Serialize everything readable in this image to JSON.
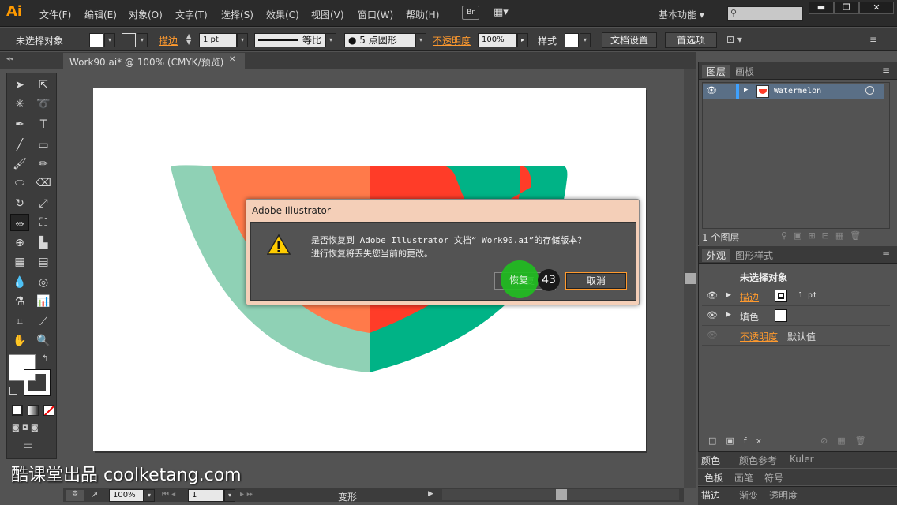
{
  "app": {
    "logo": "Ai",
    "workspace": "基本功能 ▾"
  },
  "menu": [
    "文件(F)",
    "编辑(E)",
    "对象(O)",
    "文字(T)",
    "选择(S)",
    "效果(C)",
    "视图(V)",
    "窗口(W)",
    "帮助(H)"
  ],
  "menu_buttons": {
    "bridge": "Br",
    "arrange": "▦▾"
  },
  "window_controls": {
    "minimize": "▬",
    "restore": "❐",
    "close": "✕"
  },
  "control_bar": {
    "selection": "未选择对象",
    "stroke_label": "描边",
    "stroke_weight": "1 pt",
    "stroke_profile": "等比",
    "brush": "● 5 点圆形",
    "opacity_label": "不透明度",
    "opacity_value": "100%",
    "style_label": "样式",
    "doc_setup": "文档设置",
    "preferences": "首选项"
  },
  "document_tab": {
    "title": "Work90.ai* @ 100% (CMYK/预览)",
    "close": "✕"
  },
  "status_bar": {
    "zoom": "100%",
    "page": "1",
    "tool_label": "变形"
  },
  "layers_panel": {
    "tabs": [
      "图层",
      "画板"
    ],
    "layer_name": "Watermelon",
    "count": "1 个图层"
  },
  "appearance_panel": {
    "tabs": [
      "外观",
      "图形样式"
    ],
    "title": "未选择对象",
    "stroke_label": "描边",
    "stroke_value": "1 pt",
    "fill_label": "填色",
    "opacity_label": "不透明度",
    "opacity_value": "默认值"
  },
  "collapsed_panels": [
    {
      "tabs": [
        "颜色",
        "颜色参考",
        "Kuler"
      ]
    },
    {
      "tabs": [
        "色板",
        "画笔",
        "符号"
      ]
    },
    {
      "tabs": [
        "描边",
        "渐变",
        "透明度"
      ]
    }
  ],
  "dialog": {
    "title": "Adobe Illustrator",
    "message_line1": "是否恢复到 Adobe Illustrator 文档“ Work90.ai”的存储版本？",
    "message_line2": "进行恢复将丢失您当前的更改。",
    "revert_label": "恢复",
    "cancel_label": "取消"
  },
  "tutorial": {
    "step": "43",
    "watermark": "酷课堂出品 coolketang.com"
  },
  "colors": {
    "accent": "#ff9a2e",
    "mint": "#8fd1b5",
    "green": "#00b386",
    "orange": "#ff7a4a",
    "red": "#ff3c28"
  }
}
